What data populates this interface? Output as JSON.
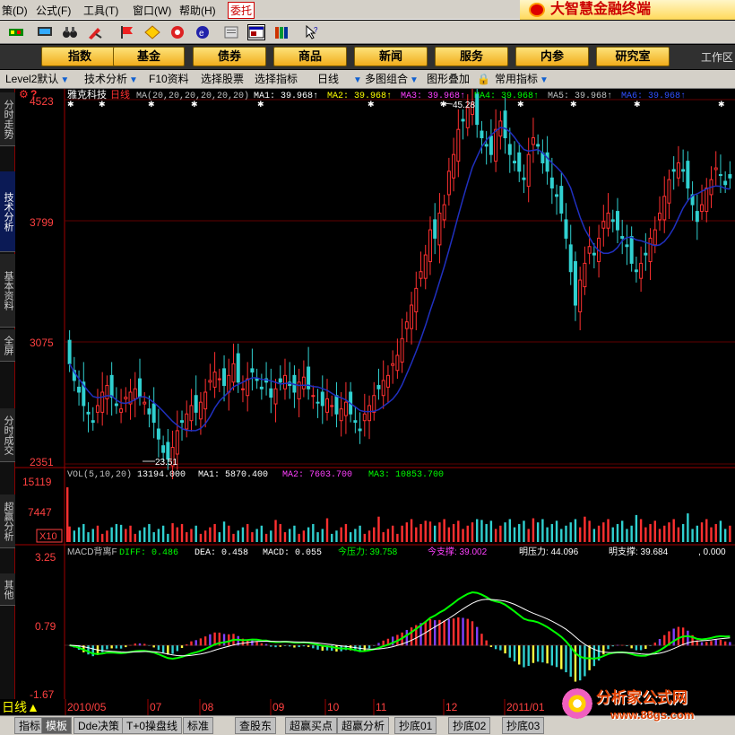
{
  "menu": {
    "items": [
      "策(D)",
      "公式(F)",
      "工具(T)",
      "窗口(W)",
      "帮助(H)"
    ],
    "active": "委托"
  },
  "brand": {
    "title": "大智慧金融终端"
  },
  "toolbar": {
    "icons": [
      "chart-icon",
      "monitor-icon",
      "binoculars-icon",
      "pen-icon",
      "flag-icon",
      "diamond-icon",
      "refresh-icon",
      "globe-icon",
      "doc-icon",
      "window-icon",
      "books-icon",
      "pointer-help-icon"
    ]
  },
  "nav": {
    "buttons": [
      "指数",
      "基金",
      "债券",
      "商品",
      "新闻",
      "服务",
      "内参",
      "研究室"
    ],
    "tail": "工作区"
  },
  "tabs": [
    {
      "label": "Level2默认",
      "dd": true
    },
    {
      "label": "技术分析",
      "dd": true
    },
    {
      "label": "F10资料",
      "dd": false
    },
    {
      "label": "选择股票",
      "dd": false
    },
    {
      "label": "选择指标",
      "dd": false
    },
    {
      "label": "日线",
      "dd": true
    },
    {
      "label": "多图组合",
      "dd": true
    },
    {
      "label": "图形叠加",
      "dd": false
    },
    {
      "label": "常用指标",
      "dd": true
    }
  ],
  "side_tabs": [
    {
      "label": "分时走势",
      "on": false
    },
    {
      "label": "技术分析",
      "on": true
    },
    {
      "label": "基本资料",
      "on": false
    },
    {
      "label": "全屏",
      "on": false
    },
    {
      "label": "分时成交",
      "on": false
    },
    {
      "label": "超赢分析",
      "on": false
    },
    {
      "label": "其他",
      "on": false
    }
  ],
  "main_panel": {
    "stock": "雅克科技",
    "period": "日线",
    "ma_params": "MA(20,20,20,20,20,20)",
    "indicators": [
      {
        "label": "MA1:",
        "value": "39.968",
        "color": "#ffffff"
      },
      {
        "label": "MA2:",
        "value": "39.968",
        "color": "#ffff00"
      },
      {
        "label": "MA3:",
        "value": "39.968",
        "color": "#ff40ff"
      },
      {
        "label": "MA4:",
        "value": "39.968",
        "color": "#00ff00"
      },
      {
        "label": "MA5:",
        "value": "39.968",
        "color": "#c0c0c0"
      },
      {
        "label": "MA6:",
        "value": "39.968",
        "color": "#3050ff"
      }
    ],
    "y_ticks": [
      "4523",
      "3799",
      "3075",
      "2351"
    ],
    "high_label": "45.28",
    "low_label": "23.51"
  },
  "vol_panel": {
    "title": "VOL(5,10,20)",
    "value": "13194.000",
    "ma1": "MA1: 5870.400",
    "ma2": "MA2: 7603.700",
    "ma3": "MA3: 10853.700",
    "y_ticks": [
      "15119",
      "7447"
    ],
    "unit": "X10"
  },
  "macd_panel": {
    "title": "MACD背离F",
    "diff": "DIFF: 0.486",
    "dea": "DEA: 0.458",
    "macd": "MACD: 0.055",
    "jin_ya": "今压力: 39.758",
    "jin_zhi": "今支撑: 39.002",
    "ming_ya": "明压力: 44.096",
    "ming_zhi": "明支撑: 39.684",
    "tail": ", 0.000",
    "y_ticks": [
      "3.25",
      "0.79",
      "-1.67"
    ]
  },
  "x_axis": [
    "2010/05",
    "07",
    "08",
    "09",
    "10",
    "11",
    "12",
    "2011/01"
  ],
  "day_tab": "日线",
  "bottom_tabs": [
    {
      "label": "指标",
      "on": false
    },
    {
      "label": "模板",
      "on": true
    },
    {
      "label": "Dde决策",
      "on": false
    },
    {
      "label": "T+0操盘线",
      "on": false
    },
    {
      "label": "标准",
      "on": false
    },
    {
      "label": "查股东",
      "on": false
    },
    {
      "label": "超赢买点",
      "on": false
    },
    {
      "label": "超赢分析",
      "on": false
    },
    {
      "label": "抄底01",
      "on": false
    },
    {
      "label": "抄底02",
      "on": false
    },
    {
      "label": "抄底03",
      "on": false
    }
  ],
  "watermark": {
    "line1": "分析家公式网",
    "line2": "www.88gs.com"
  },
  "colors": {
    "up": "#ff3030",
    "down": "#30d0d0",
    "ma_line": "#2030c0",
    "grid": "#600000",
    "axis": "#a00000"
  },
  "chart_data": {
    "type": "candlestick",
    "price_range": [
      23.51,
      45.28
    ],
    "close": [
      29.5,
      28.5,
      27.8,
      27.0,
      26.5,
      26.0,
      27.0,
      27.8,
      28.2,
      27.5,
      27.0,
      26.8,
      27.5,
      27.8,
      28.0,
      27.5,
      27.2,
      26.5,
      26.0,
      25.0,
      24.2,
      23.8,
      24.5,
      25.5,
      26.0,
      26.5,
      27.0,
      26.6,
      27.2,
      27.8,
      28.5,
      29.0,
      28.6,
      28.2,
      28.8,
      29.5,
      28.4,
      28.0,
      28.6,
      29.0,
      28.5,
      28.0,
      28.4,
      27.5,
      28.0,
      28.4,
      28.8,
      28.2,
      27.8,
      28.4,
      28.7,
      28.0,
      27.6,
      27.2,
      27.0,
      27.4,
      27.0,
      26.5,
      26.8,
      27.2,
      26.5,
      26.0,
      25.5,
      26.5,
      27.0,
      27.6,
      28.0,
      28.5,
      28.8,
      29.5,
      30.0,
      31.0,
      32.0,
      33.0,
      34.0,
      35.0,
      36.0,
      37.5,
      37.0,
      38.5,
      39.0,
      41.0,
      42.0,
      43.5,
      44.0,
      44.8,
      45.0,
      43.8,
      43.0,
      42.5,
      42.0,
      43.5,
      44.0,
      43.0,
      42.0,
      41.5,
      41.0,
      40.5,
      42.0,
      43.0,
      42.5,
      41.5,
      41.0,
      40.0,
      39.5,
      38.5,
      37.0,
      35.0,
      33.0,
      34.5,
      35.5,
      36.5,
      36.0,
      37.0,
      38.0,
      38.5,
      38.0,
      37.5,
      37.0,
      36.5,
      35.5,
      35.0,
      35.5,
      36.0,
      37.0,
      37.5,
      38.5,
      39.5,
      40.5,
      41.0,
      41.5,
      41.0,
      40.0,
      39.0,
      38.0,
      39.0,
      40.0,
      40.5,
      41.2,
      40.8,
      40.2,
      40.6
    ],
    "volume_range": [
      0,
      15119
    ],
    "volume_current": 13194,
    "macd_range": [
      -1.67,
      3.25
    ],
    "x_labels": [
      "2010/05",
      "07",
      "08",
      "09",
      "10",
      "11",
      "12",
      "2011/01"
    ]
  }
}
